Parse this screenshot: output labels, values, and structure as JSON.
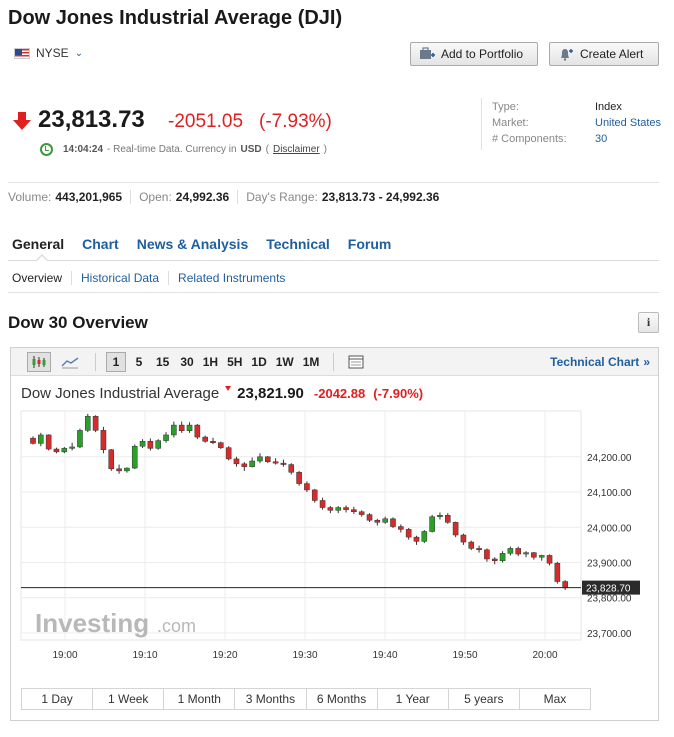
{
  "header": {
    "title": "Dow Jones Industrial Average (DJI)",
    "exchange": "NYSE",
    "add_portfolio_label": "Add to Portfolio",
    "create_alert_label": "Create Alert"
  },
  "quote": {
    "price": "23,813.73",
    "change": "-2051.05",
    "change_pct": "(-7.93%)",
    "time": "14:04:24",
    "rt_text": "- Real-time Data. Currency in",
    "currency": "USD",
    "disclaimer_label": "Disclaimer",
    "open_paren": "(",
    "close_paren": ")"
  },
  "meta": {
    "type_label": "Type:",
    "type_value": "Index",
    "market_label": "Market:",
    "market_value": "United States",
    "components_label": "# Components:",
    "components_value": "30"
  },
  "stats": {
    "volume_label": "Volume:",
    "volume_value": "443,201,965",
    "open_label": "Open:",
    "open_value": "24,992.36",
    "range_label": "Day's Range:",
    "range_value": "23,813.73 - 24,992.36"
  },
  "tabs": [
    "General",
    "Chart",
    "News & Analysis",
    "Technical",
    "Forum"
  ],
  "subtabs": [
    "Overview",
    "Historical Data",
    "Related Instruments"
  ],
  "section_title": "Dow 30 Overview",
  "toolbar": {
    "intervals": [
      "1",
      "5",
      "15",
      "30",
      "1H",
      "5H",
      "1D",
      "1W",
      "1M"
    ],
    "selected_interval": "1",
    "technical_chart_label": "Technical Chart",
    "technical_chart_arrow": "»"
  },
  "chart_header": {
    "name": "Dow Jones Industrial Average",
    "price": "23,821.90",
    "change": "-2042.88",
    "change_pct": "(-7.90%)"
  },
  "ranges": [
    "1 Day",
    "1 Week",
    "1 Month",
    "3 Months",
    "6 Months",
    "1 Year",
    "5 years",
    "Max"
  ],
  "watermark": {
    "brand": "Investing",
    "suffix": ".com"
  },
  "colors": {
    "up": "#2aa02a",
    "down": "#d62b2b",
    "accent": "#1f5e9e",
    "negative_text": "#e02020"
  },
  "chart_data": {
    "type": "candlestick",
    "x_ticks": [
      "19:00",
      "19:10",
      "19:20",
      "19:30",
      "19:40",
      "19:50",
      "20:00"
    ],
    "y_ticks": [
      "24,200.00",
      "24,100.00",
      "24,000.00",
      "23,900.00",
      "23,800.00",
      "23,700.00"
    ],
    "y_tick_values": [
      24200,
      24100,
      24000,
      23900,
      23800,
      23700
    ],
    "ylim": [
      23680,
      24330
    ],
    "current_price_label": "23,828.70",
    "current_price": 23828.7,
    "grid": true,
    "candles": [
      [
        24253,
        24258,
        24235,
        24238
      ],
      [
        24238,
        24268,
        24230,
        24262
      ],
      [
        24262,
        24264,
        24218,
        24222
      ],
      [
        24222,
        24226,
        24210,
        24214
      ],
      [
        24214,
        24228,
        24210,
        24224
      ],
      [
        24224,
        24240,
        24218,
        24228
      ],
      [
        24228,
        24280,
        24225,
        24275
      ],
      [
        24275,
        24322,
        24270,
        24315
      ],
      [
        24315,
        24318,
        24270,
        24275
      ],
      [
        24275,
        24285,
        24210,
        24220
      ],
      [
        24220,
        24222,
        24160,
        24166
      ],
      [
        24166,
        24178,
        24152,
        24160
      ],
      [
        24160,
        24170,
        24155,
        24168
      ],
      [
        24168,
        24235,
        24165,
        24230
      ],
      [
        24230,
        24250,
        24225,
        24244
      ],
      [
        24244,
        24252,
        24218,
        24224
      ],
      [
        24224,
        24250,
        24220,
        24246
      ],
      [
        24246,
        24270,
        24240,
        24262
      ],
      [
        24262,
        24300,
        24255,
        24290
      ],
      [
        24290,
        24300,
        24268,
        24274
      ],
      [
        24274,
        24298,
        24268,
        24290
      ],
      [
        24290,
        24293,
        24250,
        24256
      ],
      [
        24256,
        24260,
        24240,
        24244
      ],
      [
        24244,
        24254,
        24236,
        24240
      ],
      [
        24240,
        24243,
        24222,
        24226
      ],
      [
        24226,
        24230,
        24190,
        24194
      ],
      [
        24194,
        24200,
        24172,
        24180
      ],
      [
        24180,
        24185,
        24160,
        24172
      ],
      [
        24172,
        24198,
        24170,
        24188
      ],
      [
        24188,
        24210,
        24182,
        24200
      ],
      [
        24200,
        24202,
        24182,
        24186
      ],
      [
        24186,
        24196,
        24178,
        24182
      ],
      [
        24182,
        24192,
        24172,
        24178
      ],
      [
        24178,
        24182,
        24150,
        24156
      ],
      [
        24156,
        24160,
        24118,
        24124
      ],
      [
        24124,
        24130,
        24100,
        24106
      ],
      [
        24106,
        24109,
        24070,
        24076
      ],
      [
        24076,
        24084,
        24050,
        24056
      ],
      [
        24056,
        24060,
        24040,
        24048
      ],
      [
        24048,
        24060,
        24040,
        24056
      ],
      [
        24056,
        24062,
        24042,
        24050
      ],
      [
        24050,
        24058,
        24038,
        24044
      ],
      [
        24044,
        24048,
        24030,
        24036
      ],
      [
        24036,
        24040,
        24015,
        24020
      ],
      [
        24020,
        24024,
        24005,
        24014
      ],
      [
        24014,
        24030,
        24010,
        24024
      ],
      [
        24024,
        24028,
        23998,
        24002
      ],
      [
        24002,
        24008,
        23985,
        23994
      ],
      [
        23994,
        23998,
        23965,
        23972
      ],
      [
        23972,
        23976,
        23950,
        23960
      ],
      [
        23960,
        23992,
        23955,
        23988
      ],
      [
        23988,
        24035,
        23985,
        24030
      ],
      [
        24030,
        24042,
        24022,
        24034
      ],
      [
        24034,
        24040,
        24010,
        24014
      ],
      [
        24014,
        24016,
        23972,
        23978
      ],
      [
        23978,
        23982,
        23950,
        23958
      ],
      [
        23958,
        23962,
        23935,
        23940
      ],
      [
        23940,
        23948,
        23928,
        23936
      ],
      [
        23936,
        23940,
        23902,
        23910
      ],
      [
        23910,
        23915,
        23895,
        23905
      ],
      [
        23905,
        23932,
        23900,
        23926
      ],
      [
        23926,
        23945,
        23920,
        23940
      ],
      [
        23940,
        23945,
        23918,
        23924
      ],
      [
        23924,
        23932,
        23915,
        23928
      ],
      [
        23928,
        23930,
        23908,
        23915
      ],
      [
        23915,
        23922,
        23905,
        23920
      ],
      [
        23920,
        23923,
        23892,
        23898
      ],
      [
        23898,
        23902,
        23840,
        23846
      ],
      [
        23846,
        23850,
        23822,
        23828
      ]
    ]
  }
}
